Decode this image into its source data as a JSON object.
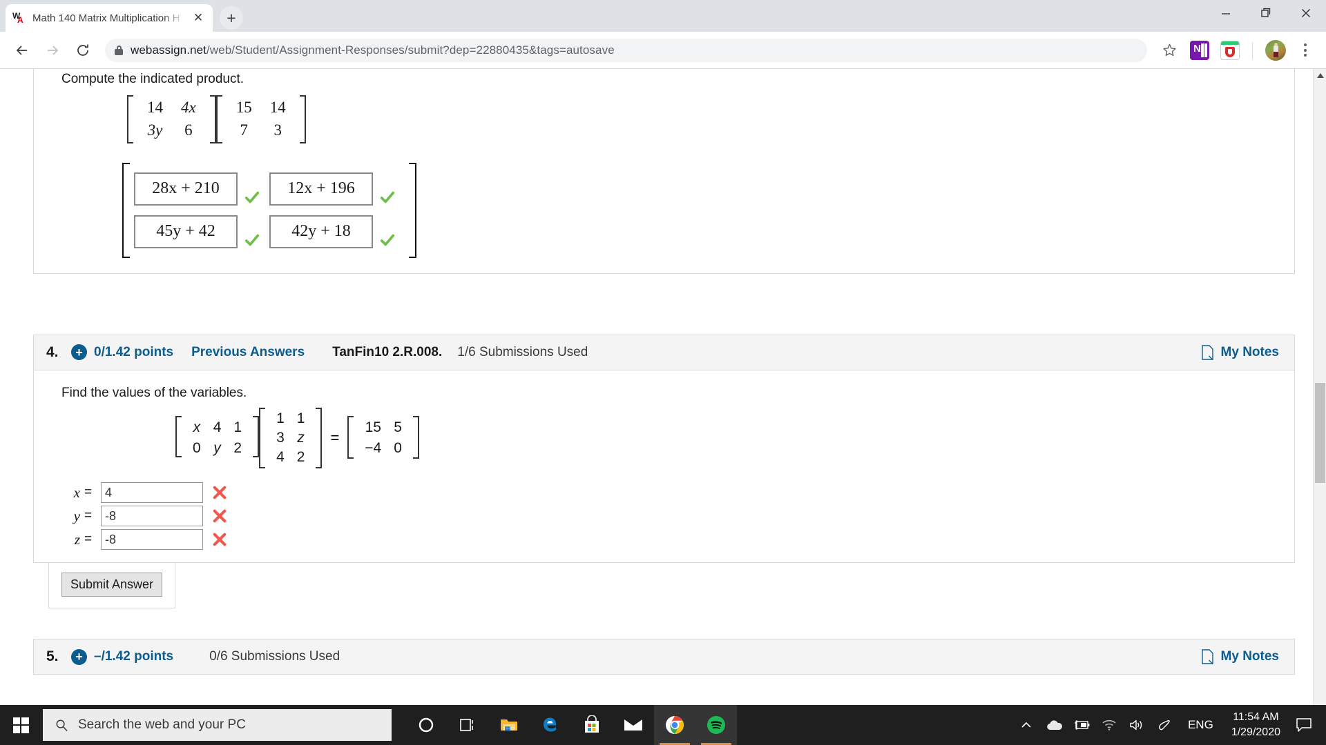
{
  "browser": {
    "tab": {
      "title": "Math 140 Matrix Multiplication H",
      "favicon": "webassign-favicon",
      "close_label": "✕"
    },
    "new_tab_label": "+",
    "window_controls": {
      "minimize": "minimize-icon",
      "maximize": "restore-icon",
      "close": "close-icon"
    },
    "nav": {
      "back": "back-arrow-icon",
      "forward": "forward-arrow-icon",
      "reload": "reload-icon"
    },
    "url_host": "webassign.net",
    "url_path": "/web/Student/Assignment-Responses/submit?dep=22880435&tags=autosave",
    "bookmark_label": "star-icon",
    "extensions": [
      {
        "name": "onenote-extension",
        "label": "N"
      },
      {
        "name": "mcafee-webadvisor-extension",
        "label": ""
      }
    ],
    "profile_label": "avatar",
    "menu_label": "chrome-menu-icon"
  },
  "question3": {
    "prompt": "Compute the indicated product.",
    "matrix_a": [
      [
        "14",
        "4x"
      ],
      [
        "3y",
        "6"
      ]
    ],
    "matrix_b": [
      [
        "15",
        "14"
      ],
      [
        "7",
        "3"
      ]
    ],
    "answers": [
      {
        "value": "28x + 210",
        "status": "correct"
      },
      {
        "value": "12x + 196",
        "status": "correct"
      },
      {
        "value": "45y + 42",
        "status": "correct"
      },
      {
        "value": "42y + 18",
        "status": "correct"
      }
    ]
  },
  "question4": {
    "number": "4.",
    "expand_badge": "+",
    "points": "0/1.42 points",
    "previous_answers": "Previous Answers",
    "textbook_ref": "TanFin10 2.R.008.",
    "submissions_used": "1/6 Submissions Used",
    "my_notes": "My Notes",
    "prompt": "Find the values of the variables.",
    "matrix_a": [
      [
        "x",
        "4",
        "1"
      ],
      [
        "0",
        "y",
        "2"
      ]
    ],
    "matrix_b": [
      [
        "1",
        "1"
      ],
      [
        "3",
        "z"
      ],
      [
        "4",
        "2"
      ]
    ],
    "equals": "=",
    "matrix_c": [
      [
        "15",
        "5"
      ],
      [
        "−4",
        "0"
      ]
    ],
    "variables": [
      {
        "label": "x",
        "eq": "=",
        "value": "4",
        "status": "incorrect"
      },
      {
        "label": "y",
        "eq": "=",
        "value": "-8",
        "status": "incorrect"
      },
      {
        "label": "z",
        "eq": "=",
        "value": "-8",
        "status": "incorrect"
      }
    ],
    "submit_label": "Submit Answer"
  },
  "question5": {
    "number": "5.",
    "expand_badge": "+",
    "points": "–/1.42 points",
    "submissions_used": "0/6 Submissions Used",
    "my_notes": "My Notes"
  },
  "taskbar": {
    "start_label": "windows-start-icon",
    "search_placeholder": "Search the web and your PC",
    "items": [
      {
        "name": "cortana",
        "active": false
      },
      {
        "name": "task-view",
        "active": false
      },
      {
        "name": "file-explorer",
        "active": false
      },
      {
        "name": "microsoft-edge",
        "active": false
      },
      {
        "name": "microsoft-store",
        "active": false
      },
      {
        "name": "mail",
        "active": false
      },
      {
        "name": "google-chrome",
        "active": true
      },
      {
        "name": "spotify",
        "active": true
      }
    ],
    "tray": {
      "chevron": "show-hidden-icons",
      "onedrive": "onedrive-icon",
      "battery": "battery-charging-icon",
      "wifi": "wifi-icon",
      "volume": "volume-icon",
      "pen": "pen-icon",
      "language": "ENG",
      "time": "11:54 AM",
      "date": "1/29/2020",
      "notifications": "action-center-icon"
    }
  },
  "colors": {
    "accent": "#0b5d8f",
    "correct": "#6ebe4a",
    "incorrect": "#f2584c",
    "chrome_bg": "#dee1e6"
  }
}
